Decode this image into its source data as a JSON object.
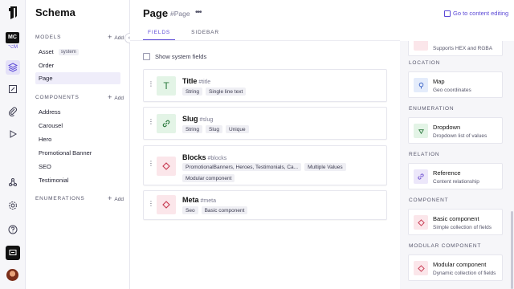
{
  "rail": {
    "project_initials": "MC",
    "env_label": "⌥M",
    "icons": [
      "logo-icon",
      "schema-icon",
      "content-icon",
      "assets-icon",
      "playground-icon",
      "webhooks-icon",
      "settings-icon",
      "help-icon",
      "chat-icon"
    ]
  },
  "sidebar": {
    "title": "Schema",
    "models_label": "MODELS",
    "models_add": "Add",
    "models": [
      {
        "label": "Asset",
        "tag": "system"
      },
      {
        "label": "Order"
      },
      {
        "label": "Page",
        "active": true
      }
    ],
    "components_label": "COMPONENTS",
    "components_add": "Add",
    "components": [
      "Address",
      "Carousel",
      "Hero",
      "Promotional Banner",
      "SEO",
      "Testimonial"
    ],
    "enumerations_label": "ENUMERATIONS",
    "enumerations_add": "Add"
  },
  "page": {
    "title": "Page",
    "api_id": "#Page",
    "more": "•••",
    "goto_content": "Go to content editing",
    "tabs": [
      "FIELDS",
      "SIDEBAR"
    ],
    "show_system_fields": "Show system fields"
  },
  "fields": [
    {
      "name": "Title",
      "api": "#title",
      "icon": "T",
      "tags": [
        "String",
        "Single line text"
      ]
    },
    {
      "name": "Slug",
      "api": "#slug",
      "icon": "link",
      "tags": [
        "String",
        "Slug",
        "Unique"
      ]
    },
    {
      "name": "Blocks",
      "api": "#blocks",
      "icon": "diamond",
      "tags": [
        "PromotionalBanners, Heroes, Testimonials, Ca...",
        "Multiple Values",
        "Modular component"
      ]
    },
    {
      "name": "Meta",
      "api": "#meta",
      "icon": "diamond",
      "tags": [
        "Seo",
        "Basic component"
      ]
    }
  ],
  "field_types": {
    "top_partial_desc": "Supports HEX and RGBA",
    "sections": [
      {
        "label": "LOCATION",
        "name": "Map",
        "desc": "Geo coordinates",
        "icon": "map-pin-icon",
        "color": "#3a63c6"
      },
      {
        "label": "ENUMERATION",
        "name": "Dropdown",
        "desc": "Dropdown list of values",
        "icon": "dropdown-icon",
        "color": "#2c7a3e"
      },
      {
        "label": "RELATION",
        "name": "Reference",
        "desc": "Content relationship",
        "icon": "link-icon",
        "color": "#6a4bd0"
      },
      {
        "label": "COMPONENT",
        "name": "Basic component",
        "desc": "Simple collection of fields",
        "icon": "diamond-icon",
        "color": "#c6364e"
      },
      {
        "label": "MODULAR COMPONENT",
        "name": "Modular component",
        "desc": "Dynamic collection of fields",
        "icon": "diamond-icon",
        "color": "#c6364e"
      }
    ]
  },
  "colors": {
    "accent": "#5b49d6",
    "panel_bg": "#f6f6f9"
  }
}
